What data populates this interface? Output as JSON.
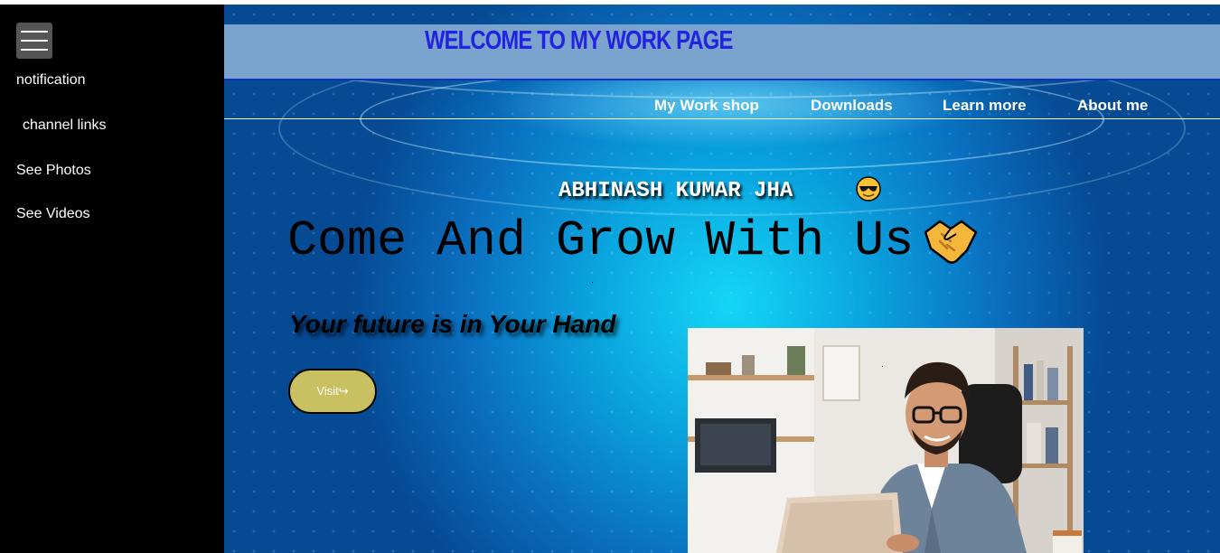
{
  "sidebar": {
    "menu_icon": "hamburger-menu-icon",
    "items": [
      {
        "label": "notification"
      },
      {
        "label": "channel links"
      },
      {
        "label": "See Photos"
      },
      {
        "label": "See Videos"
      }
    ]
  },
  "header": {
    "title": "WELCOME TO MY WORK PAGE"
  },
  "nav": {
    "items": [
      {
        "label": "My Work shop"
      },
      {
        "label": "Downloads"
      },
      {
        "label": "Learn more"
      },
      {
        "label": "About me"
      }
    ]
  },
  "hero": {
    "author": "ABHINASH KUMAR JHA",
    "author_emoji": "sunglasses-face-emoji",
    "headline": "Come And Grow With Us",
    "headline_emoji": "handshake-emoji",
    "tagline": "Your future is in Your Hand",
    "visit_label": "Visit↪",
    "photo": "man-smiling-with-laptop-photo"
  },
  "colors": {
    "sidebar_bg": "#000000",
    "header_bar": "#7aa3cd",
    "title_blue": "#2222e0",
    "button": "#c9c062"
  }
}
